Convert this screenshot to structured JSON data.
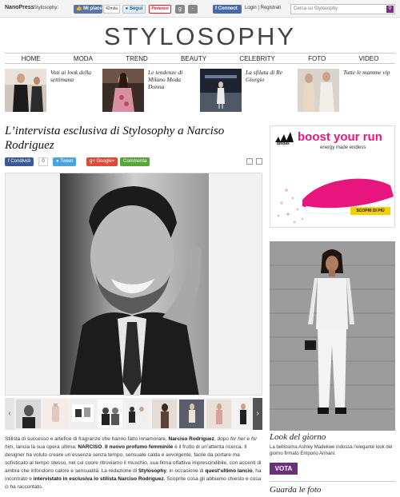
{
  "topbar": {
    "brand": "NanoPress",
    "site_label": "Stylosophy:",
    "like_label": "Mi piace",
    "like_count": "42mila",
    "follow_label": "Segui",
    "pinterest_label": "Pinterest",
    "connect_label": "Connect",
    "login_label": "Login | Registrati",
    "search_placeholder": "Cerca su Stylosophy"
  },
  "logo": "STYLOSOPHY",
  "nav": [
    "HOME",
    "MODA",
    "TREND",
    "BEAUTY",
    "CELEBRITY",
    "FOTO",
    "VIDEO"
  ],
  "teasers": [
    {
      "title": "Voti ai look della settimana"
    },
    {
      "title": "Le tendenze di Milano Moda Donna"
    },
    {
      "title": "La sfilata di Re Giorgio"
    },
    {
      "title": "Tutte le mamme vip"
    }
  ],
  "article": {
    "headline": "L’intervista esclusiva di Stylosophy a Narciso Rodriguez",
    "share": {
      "facebook": "Condividi",
      "facebook_count": "0",
      "tweet": "Tweet",
      "google": "Google+",
      "comments": "Commenta"
    },
    "body": {
      "p1": "Stilista di successo e artefice di fragranze che hanno fatto innamorare, ",
      "p1b": "Narciso Rodriguez",
      "p2": ", dopo ",
      "p2i": "for her",
      "p3": " e ",
      "p3i": "for him",
      "p4": ", lancia la sua opera ultima: ",
      "p4b": "NARCISO",
      "p5": ". ",
      "p5b": "Il nuovo profumo femminile",
      "p6": " è il frutto di un’attenta ricerca. Il designer ha voluto creare un’essenza senza tempo, sensuale calda e avvolgente, facile da portare ma sofisticato al tempo stesso, nel cui cuore ritroviamo il muschio, sua firma olfattiva imprescindibile, con accenti di ambra che infondono calore e sensualità. La redazione di ",
      "p6b": "Stylosophy",
      "p7": ", in occasione di ",
      "p7b": "quest’ultimo lancio",
      "p8": ", ha incontrato e ",
      "p8b": "intervistato in esclusiva lo stilista Narciso Rodriguez",
      "p9": ". Scoprite cosa gli abbiamo chiesto e cosa ci ha raccontato."
    }
  },
  "ad": {
    "brand": "adidas",
    "headline": "boost your run",
    "tagline": "energy made endless",
    "cta": "SCOPRI DI PIÙ"
  },
  "look": {
    "title": "Look del giorno",
    "description": "La bellissima Ashley Madekwe indossa l’elegante look del giorno firmato Emporio Armani.",
    "vote_label": "VOTA"
  },
  "photos_title": "Guarda le foto",
  "colors": {
    "accent": "#6b2f7b",
    "facebook": "#3b5998",
    "twitter": "#4aa3df",
    "google": "#dd4b39",
    "comments": "#5aa53a",
    "ad_pink": "#e8157f"
  }
}
